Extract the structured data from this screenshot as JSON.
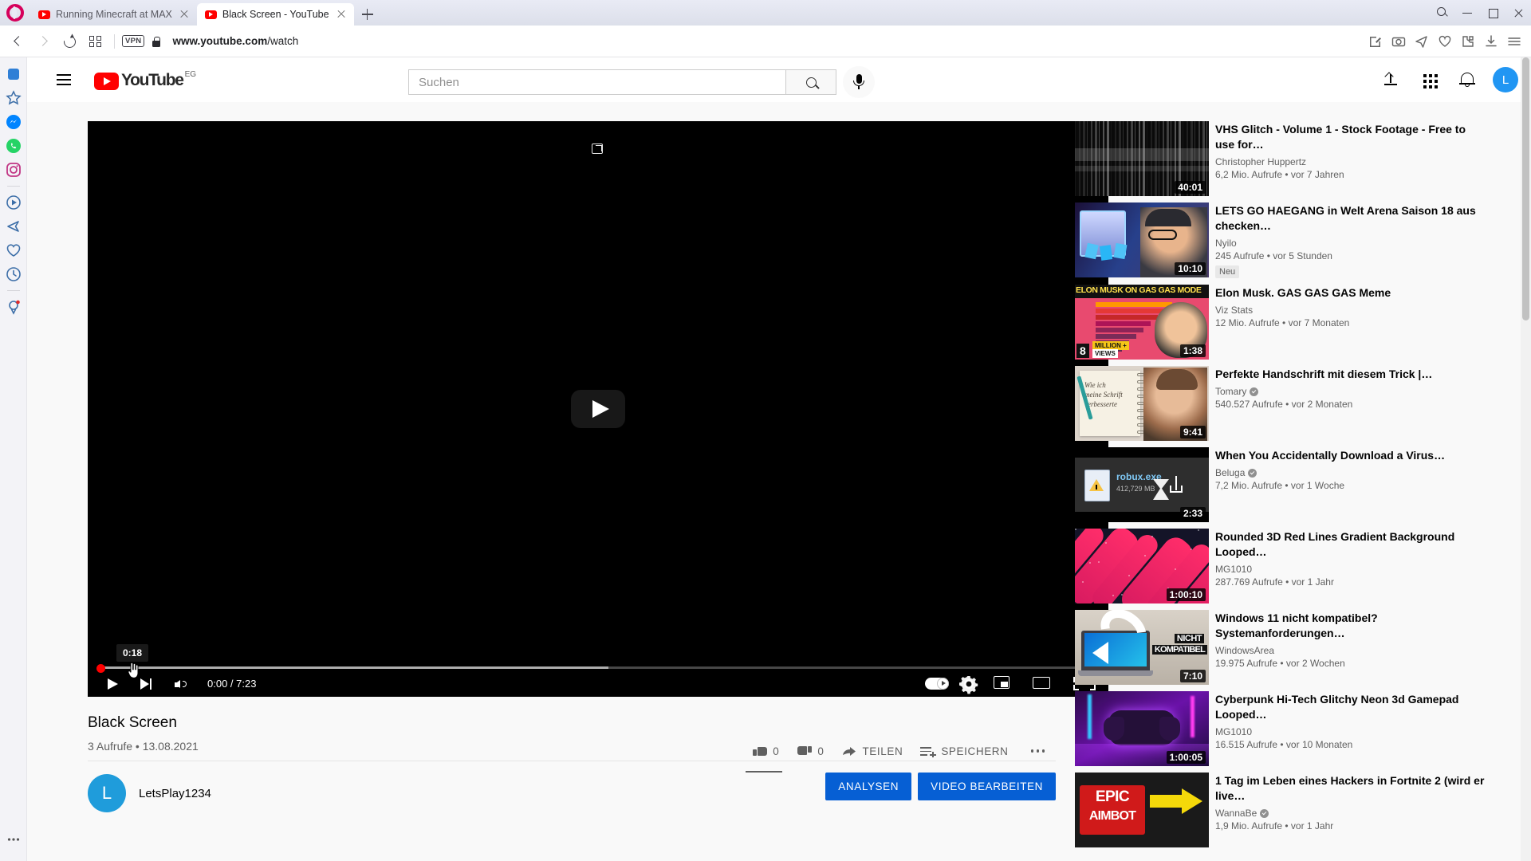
{
  "browser": {
    "name": "opera-browser",
    "tabs": [
      {
        "title": "Running Minecraft at MAX",
        "active": false
      },
      {
        "title": "Black Screen - YouTube",
        "active": true
      }
    ],
    "new_tab_label": "+",
    "url": "www.youtube.com/watch",
    "url_domain": "www.youtube.com",
    "url_path": "/watch",
    "vpn_label": "VPN",
    "icons": {
      "back": "back-arrow-icon",
      "forward": "forward-arrow-icon",
      "reload": "reload-icon",
      "tab_grid": "tab-grid-icon",
      "lock": "lock-icon",
      "search": "search-icon",
      "minimize": "minimize-icon",
      "maximize": "maximize-icon",
      "close": "close-icon"
    }
  },
  "youtube": {
    "logo_text": "YouTube",
    "country_code": "EG",
    "search": {
      "value": "",
      "placeholder": "Suchen"
    },
    "avatar_letter": "L",
    "player": {
      "tooltip_time": "0:18",
      "current_time": "0:00",
      "duration": "7:23",
      "time_display": "0:00 / 7:23",
      "progress_played_percent": 0.15,
      "progress_loaded_percent": 51,
      "autoplay_on": true
    },
    "video": {
      "title": "Black Screen",
      "views": "3 Aufrufe",
      "date": "13.08.2021",
      "stats_line": "3 Aufrufe • 13.08.2021",
      "like_count": "0",
      "dislike_count": "0",
      "share_label": "TEILEN",
      "save_label": "SPEICHERN"
    },
    "channel": {
      "name": "LetsPlay1234",
      "avatar_letter": "L",
      "analytics_button": "ANALYSEN",
      "edit_button": "VIDEO BEARBEITEN"
    },
    "related": [
      {
        "title": "VHS Glitch - Volume 1 - Stock Footage - Free to use for…",
        "channel": "Christopher Huppertz",
        "verified": false,
        "meta": "6,2 Mio. Aufrufe • vor 7 Jahren",
        "duration": "40:01",
        "badge": "",
        "thumb_style": "vhs"
      },
      {
        "title": "LETS GO HAEGANG in Welt Arena Saison 18 aus checken…",
        "channel": "Nyilo",
        "verified": false,
        "meta": "245 Aufrufe • vor 5 Stunden",
        "duration": "10:10",
        "badge": "Neu",
        "thumb_style": "anime"
      },
      {
        "title": "Elon Musk. GAS GAS GAS Meme",
        "channel": "Viz Stats",
        "verified": false,
        "meta": "12 Mio. Aufrufe • vor 7 Monaten",
        "duration": "1:38",
        "badge": "",
        "thumb_style": "elon",
        "thumb_text": "ELON MUSK ON GAS GAS MODE",
        "thumb_sub": "8 MILLION + VIEWS"
      },
      {
        "title": "Perfekte Handschrift mit diesem Trick |…",
        "channel": "Tomary",
        "verified": true,
        "meta": "540.527 Aufrufe • vor 2 Monaten",
        "duration": "9:41",
        "badge": "",
        "thumb_style": "handwriting",
        "thumb_text": "Wie ich meine Schrift verbesserte"
      },
      {
        "title": "When You Accidentally Download a Virus…",
        "channel": "Beluga",
        "verified": true,
        "meta": "7,2 Mio. Aufrufe • vor 1 Woche",
        "duration": "2:33",
        "badge": "",
        "thumb_style": "virus",
        "thumb_text": "robux.exe",
        "thumb_sub": "412,729 MB"
      },
      {
        "title": "Rounded 3D Red Lines Gradient Background Looped…",
        "channel": "MG1010",
        "verified": false,
        "meta": "287.769 Aufrufe • vor 1 Jahr",
        "duration": "1:00:10",
        "badge": "",
        "thumb_style": "redlines"
      },
      {
        "title": "Windows 11 nicht kompatibel? Systemanforderungen…",
        "channel": "WindowsArea",
        "verified": false,
        "meta": "19.975 Aufrufe • vor 2 Wochen",
        "duration": "7:10",
        "badge": "",
        "thumb_style": "windows",
        "thumb_text": "NICHT KOMPATIBEL"
      },
      {
        "title": "Cyberpunk Hi-Tech Glitchy Neon 3d Gamepad Looped…",
        "channel": "MG1010",
        "verified": false,
        "meta": "16.515 Aufrufe • vor 10 Monaten",
        "duration": "1:00:05",
        "badge": "",
        "thumb_style": "cyberpunk"
      },
      {
        "title": "1 Tag im Leben eines Hackers in Fortnite 2 (wird er live…",
        "channel": "WannaBe",
        "verified": true,
        "meta": "1,9 Mio. Aufrufe • vor 1 Jahr",
        "duration": "",
        "badge": "",
        "thumb_style": "epic",
        "thumb_text": "EPIC AIMBOT"
      }
    ]
  },
  "colors": {
    "youtube_red": "#ff0000",
    "blue_button": "#065fd4",
    "avatar_blue": "#2196f3",
    "channel_avatar_blue": "#1f9cdb",
    "page_bg": "#f9f9f9",
    "text_primary": "#030303",
    "text_secondary": "#606060"
  }
}
